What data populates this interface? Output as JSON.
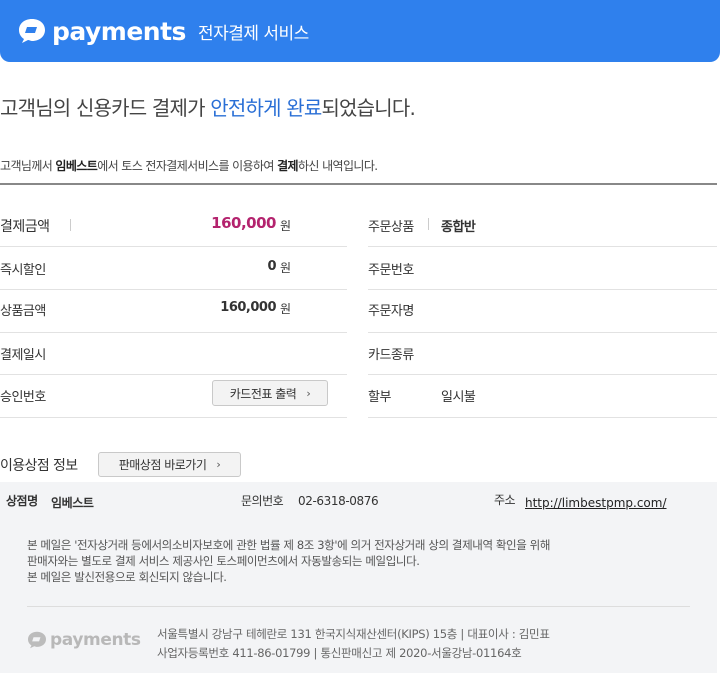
{
  "header": {
    "logo_text": "payments",
    "subtitle": "전자결제 서비스",
    "bg_color": "#2f80ed"
  },
  "headline": {
    "part1": "고객님의 신용카드 결제가 ",
    "highlight1": "안전하게 완료",
    "part2": "되었습니다."
  },
  "intro": {
    "prefix": "고객님께서 ",
    "store": "임베스트",
    "middle": "에서 토스 전자결제서비스를 이용하여 ",
    "bold": "결제",
    "suffix": "하신 내역입니다."
  },
  "details": {
    "left": [
      {
        "label": "결제금액",
        "value": "160,000",
        "unit": "원"
      },
      {
        "label": "즉시할인",
        "value": "0",
        "unit": "원"
      },
      {
        "label": "상품금액",
        "value": "160,000",
        "unit": "원"
      },
      {
        "label": "결제일시",
        "value": ""
      },
      {
        "label": "승인번호",
        "button": "카드전표 출력"
      }
    ],
    "right": [
      {
        "label": "주문상품",
        "value": "종합반"
      },
      {
        "label": "주문번호",
        "value": ""
      },
      {
        "label": "주문자명",
        "value": ""
      },
      {
        "label": "카드종류",
        "value": ""
      },
      {
        "label": "할부",
        "value": "일시불"
      }
    ]
  },
  "store_info": {
    "title": "이용상점 정보",
    "button": "판매상점 바로가기",
    "name_label": "상점명",
    "name_value": "임베스트",
    "phone_label": "문의번호",
    "phone_value": "02-6318-0876",
    "address_label": "주소",
    "address_value": "http://limbestpmp.com/"
  },
  "notice": {
    "line1": "본 메일은 '전자상거래 등에서의소비자보호에 관한 법률 제 8조 3항'에 의거 전자상거래 상의 결제내역 확인을 위해",
    "line2": "판매자와는 별도로 결제 서비스 제공사인 토스페이먼츠에서 자동발송되는 메일입니다.",
    "line3": "본 메일은 발신전용으로 회신되지 않습니다."
  },
  "footer": {
    "logo_text": "payments",
    "line1": "서울특별시 강남구 테헤란로 131 한국지식재산센터(KIPS) 15층  |  대표이사 : 김민표",
    "line2": "사업자등록번호 411-86-01799  |  통신판매신고 제 2020-서울강남-01164호"
  },
  "colors": {
    "accent_blue": "#2f80ed",
    "amount_magenta": "#b4236e",
    "highlight_blue": "#2a6fd6"
  }
}
